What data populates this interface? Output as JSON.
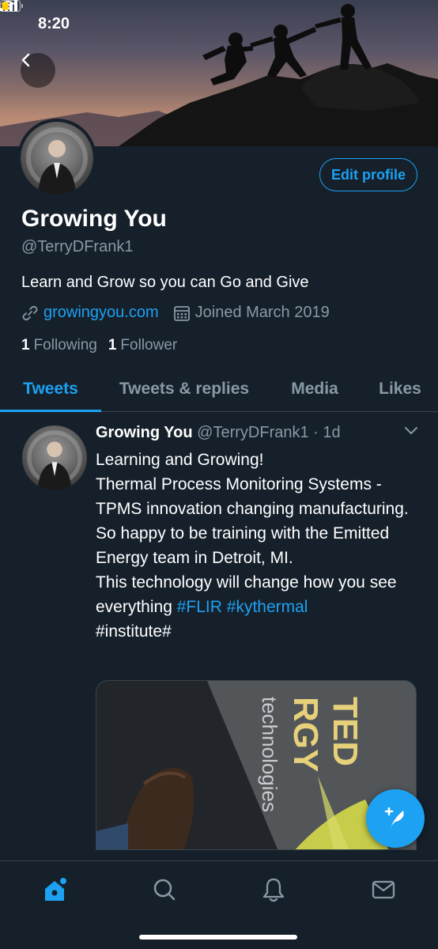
{
  "status_bar": {
    "time": "8:20"
  },
  "profile": {
    "name": "Growing You",
    "handle": "@TerryDFrank1",
    "bio": "Learn and Grow so you can Go and Give",
    "website": "growingyou.com",
    "joined": "Joined March 2019",
    "following_count": "1",
    "following_label": "Following",
    "followers_count": "1",
    "followers_label": "Follower",
    "edit_label": "Edit profile"
  },
  "tabs": [
    {
      "label": "Tweets",
      "active": true
    },
    {
      "label": "Tweets & replies",
      "active": false
    },
    {
      "label": "Media",
      "active": false
    },
    {
      "label": "Likes",
      "active": false
    }
  ],
  "tweet": {
    "name": "Growing You",
    "handle_time": "@TerryDFrank1 · 1d",
    "lines": [
      "Learning and Growing!",
      "Thermal Process Monitoring Systems - TPMS innovation changing manufacturing.",
      "So happy to be training with the Emitted Energy team in Detroit, MI.",
      "This technology will change how you see everything"
    ],
    "hashtags": [
      "#FLIR",
      "#kythermal"
    ],
    "tail": "#institute#",
    "media_text": {
      "line1": "TED",
      "line2": "RGY",
      "line3": "technologies"
    }
  },
  "bottom_nav": [
    "home-icon",
    "search-icon",
    "notifications-icon",
    "messages-icon"
  ],
  "colors": {
    "accent": "#1da1f2",
    "background": "#15202b",
    "muted": "#8899a6",
    "divider": "#38444d"
  }
}
